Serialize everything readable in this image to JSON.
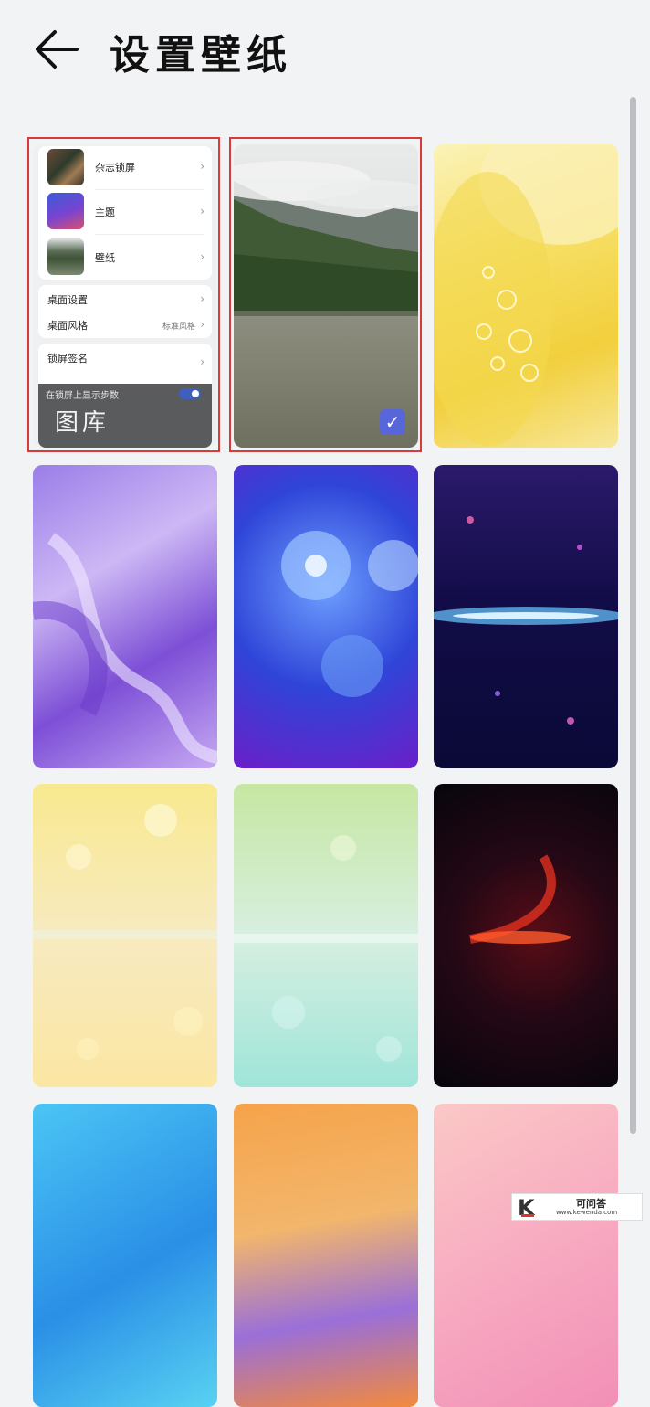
{
  "header": {
    "title": "设置壁纸",
    "back_icon": "arrow-left-icon"
  },
  "gallery_tile": {
    "rows_top": [
      {
        "label": "杂志锁屏",
        "thumb": "magazine-thumb"
      },
      {
        "label": "主题",
        "thumb": "theme-thumb"
      },
      {
        "label": "壁纸",
        "thumb": "wallpaper-thumb"
      }
    ],
    "rows_bottom": [
      {
        "label": "桌面设置",
        "value": ""
      },
      {
        "label": "桌面风格",
        "value": "标准风格"
      }
    ],
    "lock_signature": "锁屏签名",
    "step_count_label": "在锁屏上显示步数",
    "step_count_enabled": true,
    "label": "图库"
  },
  "wallpapers": [
    {
      "name": "mountain-lake",
      "selected": true
    },
    {
      "name": "yellow-petal",
      "selected": false
    },
    {
      "name": "purple-smoke",
      "selected": false
    },
    {
      "name": "blue-flower",
      "selected": false
    },
    {
      "name": "galaxy-glitter",
      "selected": false
    },
    {
      "name": "yellow-bokeh",
      "selected": false
    },
    {
      "name": "mint-bokeh",
      "selected": false
    },
    {
      "name": "red-glitter",
      "selected": false
    },
    {
      "name": "blue-petal",
      "selected": false
    },
    {
      "name": "orange-painting",
      "selected": false
    },
    {
      "name": "pink-flower",
      "selected": false
    }
  ],
  "colors": {
    "selection_frame": "#d93a3a",
    "check_badge": "#5866dc"
  },
  "watermark": {
    "name": "可问答",
    "url": "www.kewenda.com",
    "logo": "K"
  }
}
